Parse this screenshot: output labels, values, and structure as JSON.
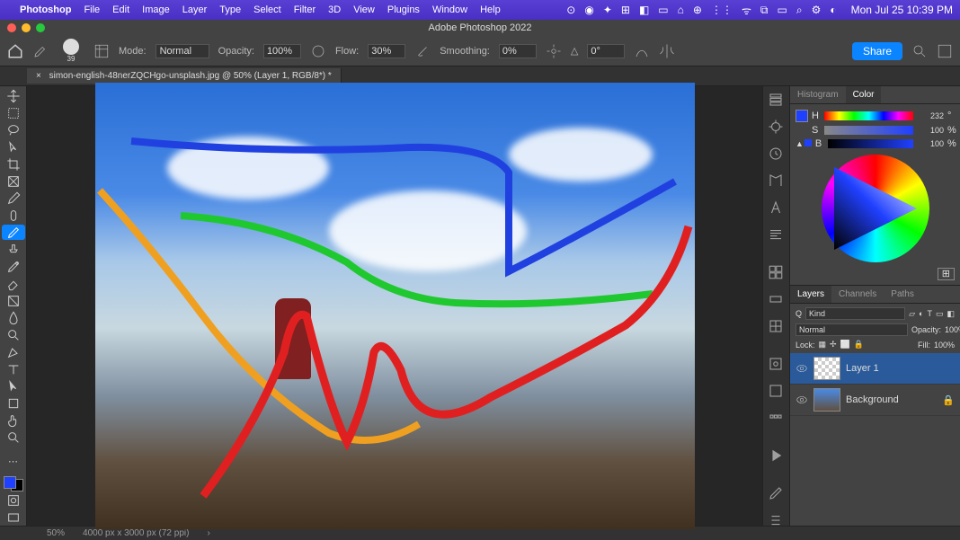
{
  "menubar": {
    "app": "Photoshop",
    "items": [
      "File",
      "Edit",
      "Image",
      "Layer",
      "Type",
      "Select",
      "Filter",
      "3D",
      "View",
      "Plugins",
      "Window",
      "Help"
    ],
    "clock": "Mon Jul 25  10:39 PM"
  },
  "window": {
    "title": "Adobe Photoshop 2022"
  },
  "options": {
    "brush_size": "39",
    "mode_label": "Mode:",
    "mode_value": "Normal",
    "opacity_label": "Opacity:",
    "opacity_value": "100%",
    "flow_label": "Flow:",
    "flow_value": "30%",
    "smoothing_label": "Smoothing:",
    "smoothing_value": "0%",
    "angle_label": "△",
    "angle_value": "0°",
    "share": "Share"
  },
  "tab": {
    "label": "simon-english-48nerZQCHgo-unsplash.jpg @ 50% (Layer 1, RGB/8*) *"
  },
  "color_panel": {
    "tab_histogram": "Histogram",
    "tab_color": "Color",
    "h_label": "H",
    "h_value": "232",
    "s_label": "S",
    "s_value": "100",
    "s_unit": "%",
    "b_label": "B",
    "b_value": "100",
    "b_unit": "%"
  },
  "layers_panel": {
    "tab_layers": "Layers",
    "tab_channels": "Channels",
    "tab_paths": "Paths",
    "kind_label": "Kind",
    "blend_label": "Normal",
    "opacity_label": "Opacity:",
    "opacity_value": "100%",
    "lock_label": "Lock:",
    "fill_label": "Fill:",
    "fill_value": "100%",
    "layers": [
      {
        "name": "Layer 1",
        "selected": true
      },
      {
        "name": "Background",
        "selected": false,
        "locked": true
      }
    ]
  },
  "status": {
    "zoom": "50%",
    "dims": "4000 px x 3000 px (72 ppi)"
  }
}
